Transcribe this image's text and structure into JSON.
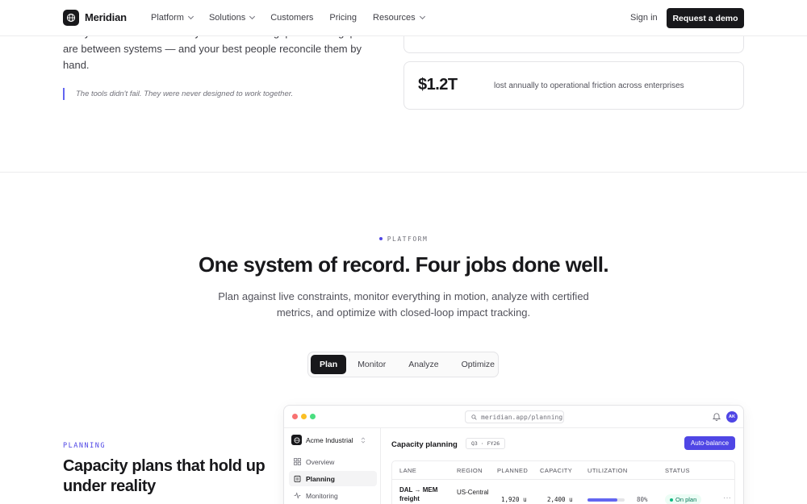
{
  "nav": {
    "brand": "Meridian",
    "links": [
      {
        "label": "Platform",
        "dropdown": true
      },
      {
        "label": "Solutions",
        "dropdown": true
      },
      {
        "label": "Customers",
        "dropdown": false
      },
      {
        "label": "Pricing",
        "dropdown": false
      },
      {
        "label": "Resources",
        "dropdown": true
      }
    ],
    "sign_in": "Sign in",
    "cta": "Request a demo"
  },
  "problem": {
    "lead": "Every team added another system to close a gap. Now the gaps are between systems — and your best people reconcile them by hand.",
    "quote": "The tools didn't fail. They were never designed to work together.",
    "stat_value": "$1.2T",
    "stat_desc": "lost annually to operational friction across enterprises"
  },
  "platform": {
    "eyebrow": "PLATFORM",
    "title": "One system of record. Four jobs done well.",
    "subtitle": "Plan against live constraints, monitor everything in motion, analyze with certified metrics, and optimize with closed-loop impact tracking.",
    "tabs": [
      {
        "label": "Plan",
        "active": true
      },
      {
        "label": "Monitor",
        "active": false
      },
      {
        "label": "Analyze",
        "active": false
      },
      {
        "label": "Optimize",
        "active": false
      }
    ],
    "feature_eyebrow": "PLANNING",
    "feature_title": "Capacity plans that hold up under reality"
  },
  "app": {
    "url": "meridian.app/planning",
    "avatar": "AK",
    "org": "Acme Industrial",
    "sidebar": [
      {
        "label": "Overview",
        "active": false
      },
      {
        "label": "Planning",
        "active": true
      },
      {
        "label": "Monitoring",
        "active": false
      }
    ],
    "page_title": "Capacity planning",
    "period_badge": "Q3 · FY26",
    "action": "Auto-balance",
    "table": {
      "headers": [
        "LANE",
        "REGION",
        "PLANNED",
        "CAPACITY",
        "UTILIZATION",
        "STATUS"
      ],
      "rows": [
        {
          "lane": "DAL → MEM freight",
          "region": "US-Central",
          "planned": "1,920 u",
          "capacity": "2,400 u",
          "utilization": 80,
          "utilization_label": "80%",
          "status": "On plan"
        }
      ]
    }
  },
  "colors": {
    "accent": "#4f46e5",
    "dark": "#18181b",
    "success": "#10b981"
  }
}
